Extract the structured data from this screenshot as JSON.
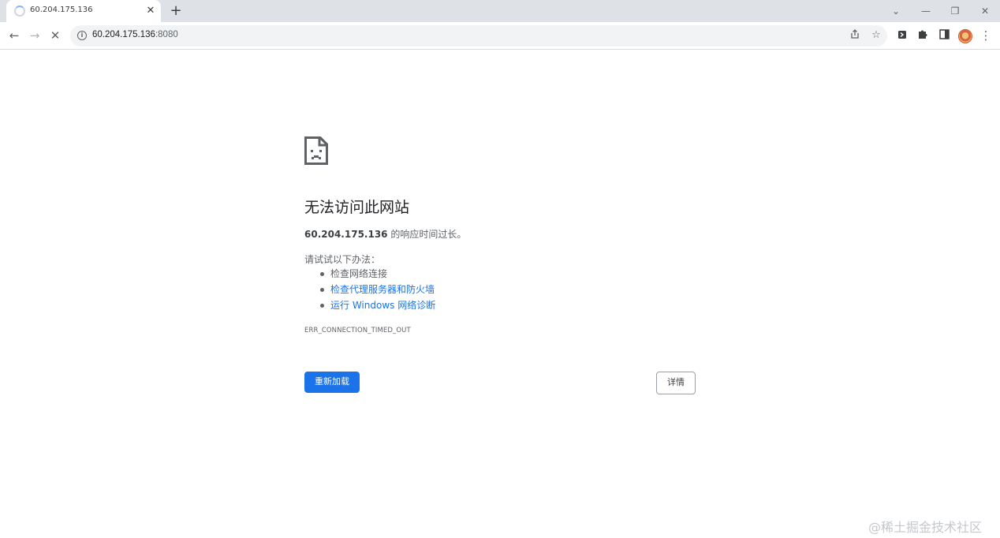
{
  "browser": {
    "tab": {
      "title": "60.204.175.136",
      "close_glyph": "✕"
    },
    "new_tab_glyph": "+",
    "window_controls": [
      "⌄",
      "—",
      "❐",
      "✕"
    ],
    "toolbar": {
      "back": "←",
      "forward": "→",
      "stop": "✕"
    },
    "address_bar": {
      "host": "60.204.175.136",
      "port": ":8080"
    },
    "omnibox_icons": [
      "share-icon",
      "star-icon"
    ],
    "extension_icons": [
      "extension-icon",
      "puzzle-icon",
      "side-panel-icon"
    ],
    "menu_glyph": "⋮"
  },
  "error_page": {
    "icon": "sad-page-icon",
    "title": "无法访问此网站",
    "host": "60.204.175.136",
    "message": " 的响应时间过长。",
    "try_label": "请试试以下办法：",
    "suggestions": [
      {
        "text": "检查网络连接",
        "link": false
      },
      {
        "text": "检查代理服务器和防火墙",
        "link": true
      },
      {
        "text": "运行 Windows 网络诊断",
        "link": true
      }
    ],
    "error_code": "ERR_CONNECTION_TIMED_OUT",
    "reload_label": "重新加载",
    "details_label": "详情"
  },
  "watermark": "@稀土掘金技术社区",
  "colors": {
    "accent": "#1a73e8",
    "tabstrip": "#dee1e6",
    "text_secondary": "#5f6368"
  }
}
